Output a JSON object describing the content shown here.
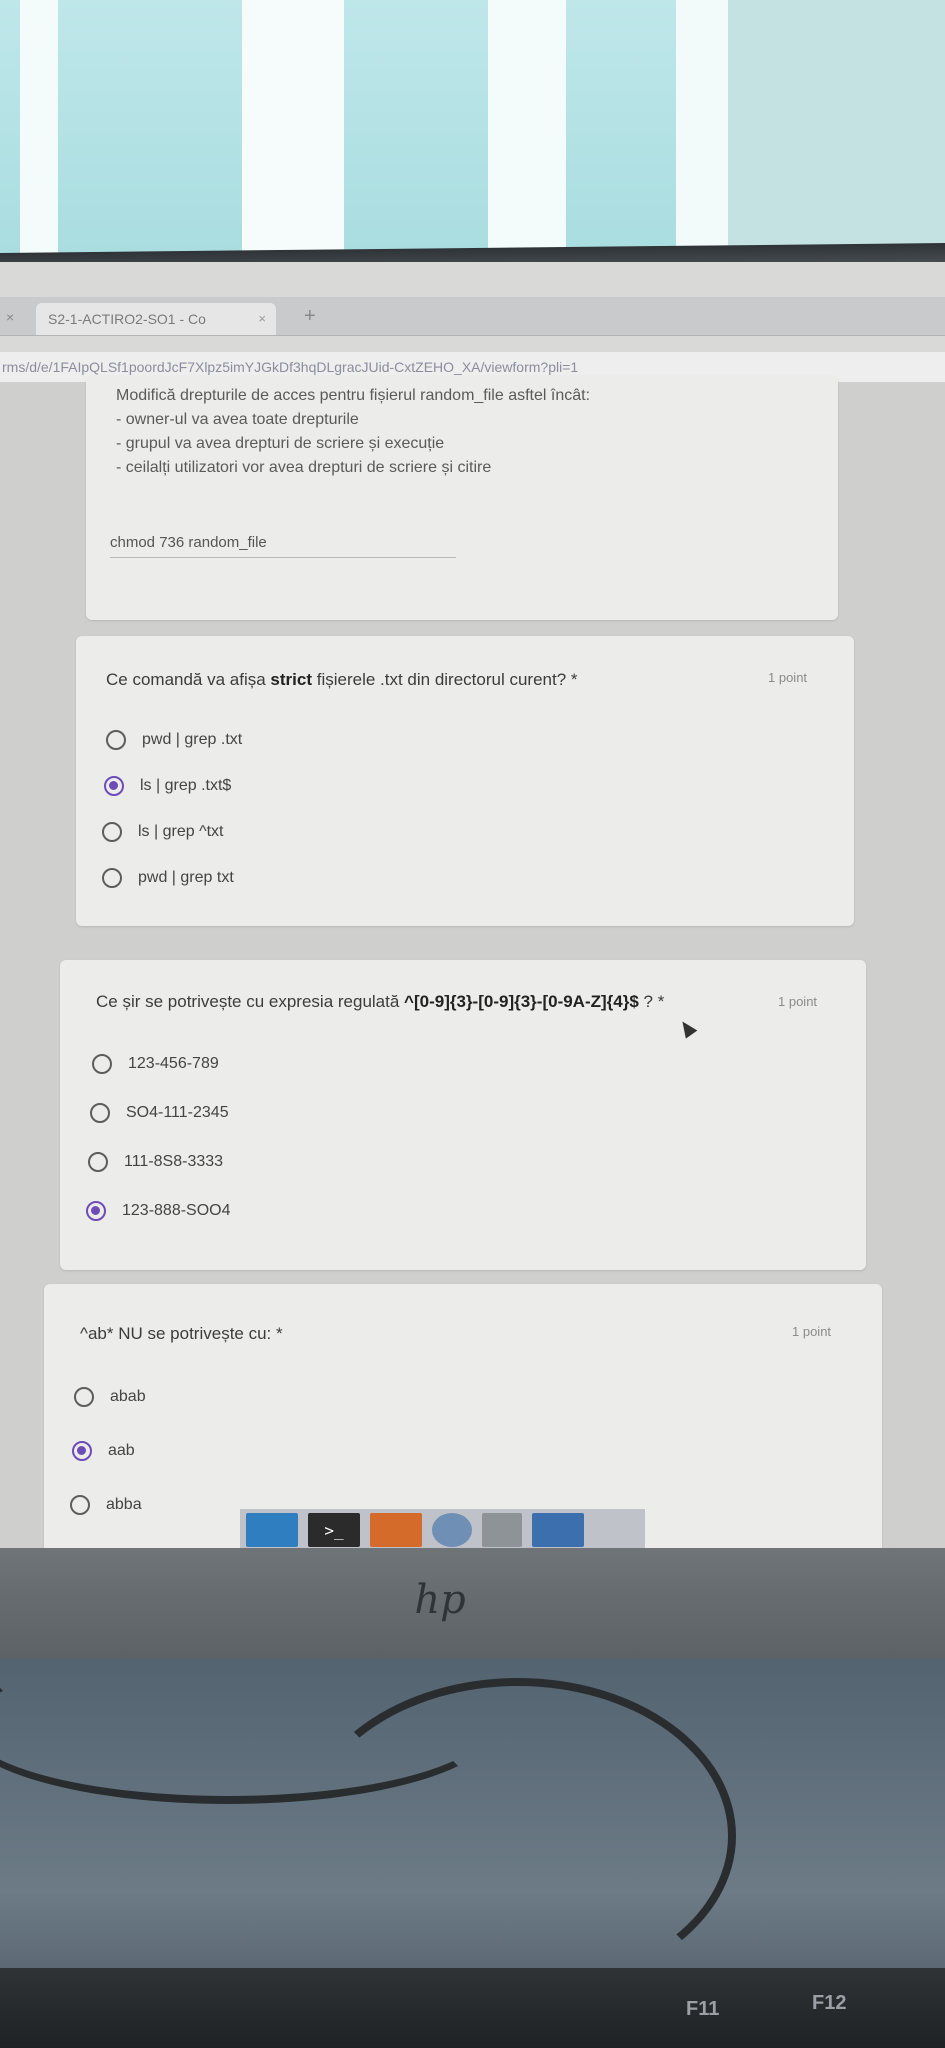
{
  "browser": {
    "tab_title": "S2-1-ACTIRO2-SO1 - Co",
    "tab_close": "×",
    "left_close": "×",
    "new_tab": "+",
    "url": "rms/d/e/1FAIpQLSf1poordJcF7Xlpz5imYJGkDf3hqDLgracJUid-CxtZEHO_XA/viewform?pli=1"
  },
  "previous_question": {
    "lines": [
      "Modifică drepturile de acces pentru fișierul random_file asftel încât:",
      "- owner-ul va avea toate drepturile",
      "- grupul va avea drepturi de scriere și execuție",
      "- ceilalți utilizatori vor avea drepturi de scriere și citire"
    ],
    "answer": "chmod 736 random_file"
  },
  "question_txt": {
    "title_pre": "Ce comandă va afișa ",
    "title_bold": "strict",
    "title_post": " fișierele .txt din directorul curent? *",
    "points": "1 point",
    "options": [
      "pwd | grep .txt",
      "ls | grep .txt$",
      "ls | grep ^txt",
      "pwd | grep txt"
    ],
    "selected_index": 1
  },
  "question_regex": {
    "title_pre": "Ce șir se potrivește cu expresia regulată ",
    "title_bold": "^[0-9]{3}-[0-9]{3}-[0-9A-Z]{4}$",
    "title_post": " ? *",
    "points": "1 point",
    "options": [
      "123-456-789",
      "SO4-111-2345",
      "111-8S8-3333",
      "123-888-SOO4"
    ],
    "selected_index": 3
  },
  "question_ab": {
    "title": "^ab* NU se potrivește cu: *",
    "points": "1 point",
    "options": [
      "abab",
      "aab",
      "abba"
    ],
    "selected_index": 1
  },
  "taskbar": {
    "terminal_glyph": ">_"
  },
  "keyboard": {
    "keys": [
      "F11",
      "F12"
    ]
  },
  "colors": {
    "accent": "#6e4cb8"
  }
}
